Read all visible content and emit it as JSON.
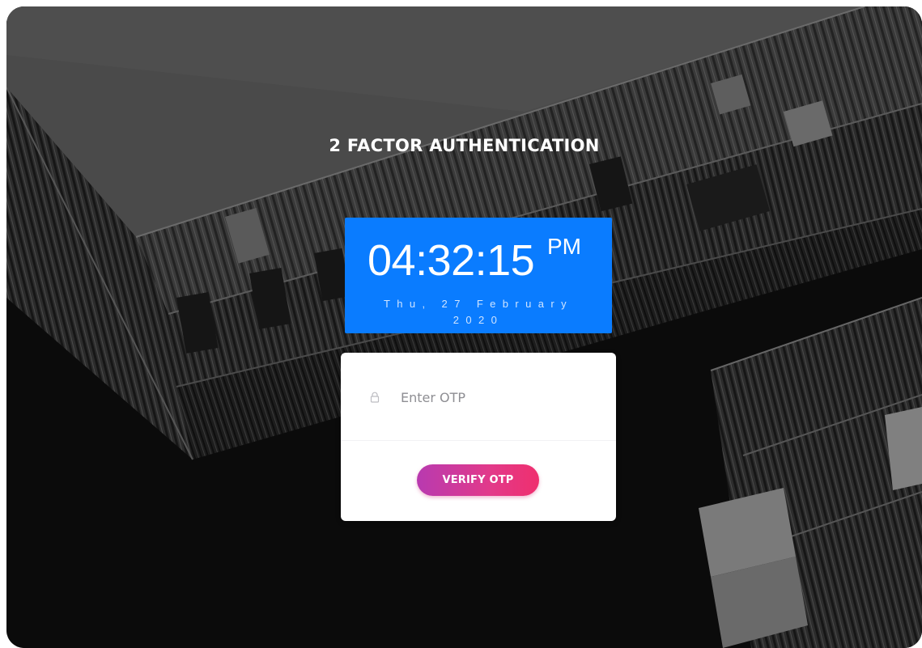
{
  "page": {
    "title": "2 FACTOR AUTHENTICATION"
  },
  "clock": {
    "time": "04:32:15",
    "ampm": "PM",
    "date": "Thu, 27 February 2020",
    "background_color": "#0a7cff"
  },
  "otp_form": {
    "input_placeholder": "Enter OTP",
    "input_value": "",
    "verify_label": "VERIFY OTP",
    "button_gradient": [
      "#b83ab0",
      "#ef2f6e"
    ],
    "lock_icon": "lock-icon"
  },
  "background": {
    "description_icon": "building-photo",
    "base_color": "#0b0b0b"
  }
}
